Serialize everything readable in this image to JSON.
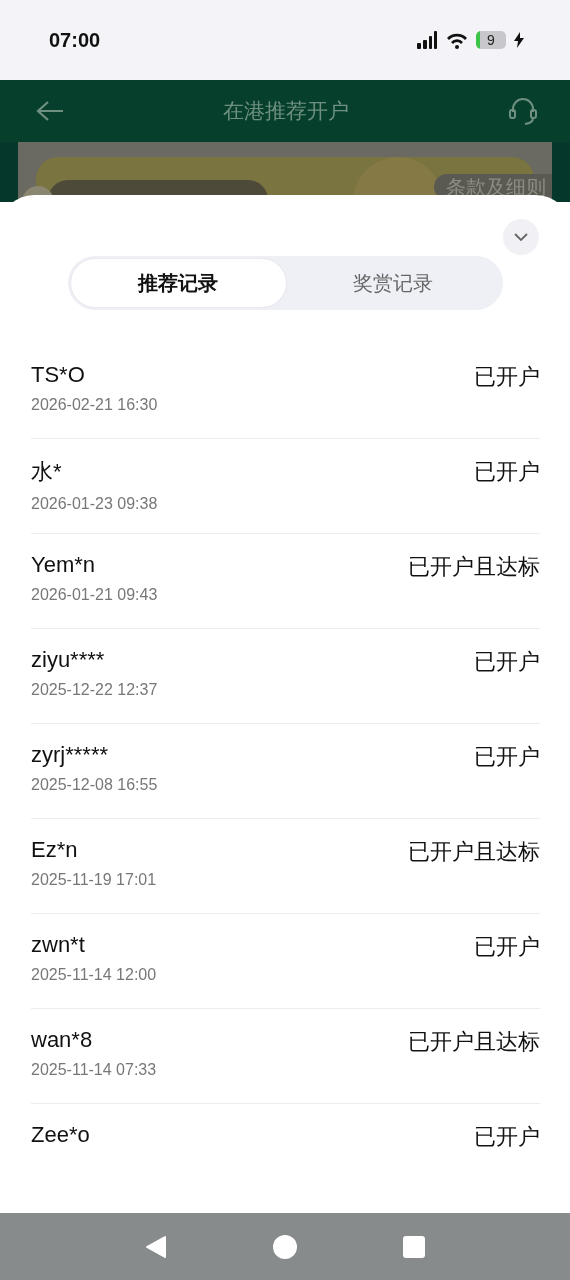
{
  "status_bar": {
    "time": "07:00",
    "battery": "9"
  },
  "header": {
    "title": "在港推荐开户"
  },
  "banner": {
    "kind": "picture",
    "terms": "条款及细则"
  },
  "sheet": {
    "tabs": [
      {
        "label": "推荐记录",
        "selected": true
      },
      {
        "label": "奖赏记录",
        "selected": false
      }
    ],
    "records": [
      {
        "name": "TS*O",
        "date": "2026-02-21 16:30",
        "status": "已开户"
      },
      {
        "name": "水*",
        "date": "2026-01-23 09:38",
        "status": "已开户"
      },
      {
        "name": "Yem*n",
        "date": "2026-01-21 09:43",
        "status": "已开户且达标"
      },
      {
        "name": "ziyu****",
        "date": "2025-12-22 12:37",
        "status": "已开户"
      },
      {
        "name": "zyrj*****",
        "date": "2025-12-08 16:55",
        "status": "已开户"
      },
      {
        "name": "Ez*n",
        "date": "2025-11-19 17:01",
        "status": "已开户且达标"
      },
      {
        "name": "zwn*t",
        "date": "2025-11-14 12:00",
        "status": "已开户"
      },
      {
        "name": "wan*8",
        "date": "2025-11-14 07:33",
        "status": "已开户且达标"
      },
      {
        "name": "Zee*o",
        "status": "已开户"
      }
    ]
  }
}
